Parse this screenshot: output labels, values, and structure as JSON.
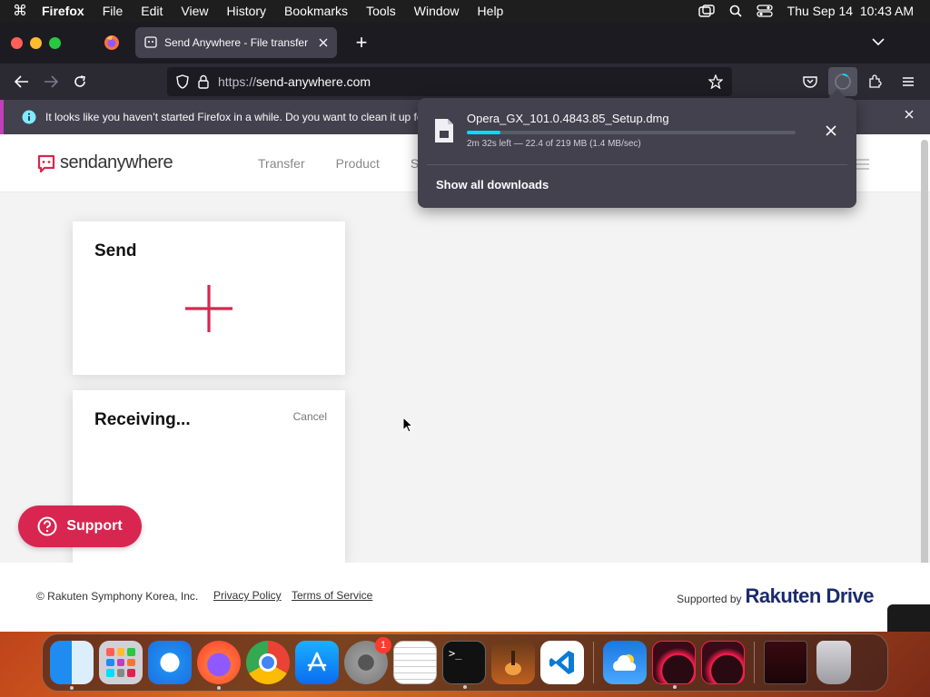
{
  "menubar": {
    "app": "Firefox",
    "items": [
      "File",
      "Edit",
      "View",
      "History",
      "Bookmarks",
      "Tools",
      "Window",
      "Help"
    ],
    "clock": "Thu Sep 14  10:43 AM"
  },
  "browser": {
    "tab_title": "Send Anywhere - File transfer",
    "url_proto": "https://",
    "url_host": "send-anywhere.com",
    "infobar_text": "It looks like you haven’t started Firefox in a while. Do you want to clean it up for"
  },
  "site": {
    "logo_text": "sendanywhere",
    "nav": [
      "Transfer",
      "Product",
      "Se"
    ],
    "send_title": "Send",
    "receiving_title": "Receiving...",
    "cancel_label": "Cancel",
    "support_label": "Support",
    "footer": {
      "copyright": "© Rakuten Symphony Korea, Inc.",
      "privacy": "Privacy Policy",
      "terms": "Terms of Service",
      "supported_by": "Supported by",
      "brand": "Rakuten Drive"
    }
  },
  "downloads": {
    "file_name": "Opera_GX_101.0.4843.85_Setup.dmg",
    "status": "2m 32s left — 22.4 of 219 MB (1.4 MB/sec)",
    "progress_fraction": 0.102,
    "show_all": "Show all downloads"
  },
  "dock": {
    "badge_count": "1"
  },
  "colors": {
    "accent": "#d82650",
    "progress": "#00ddff",
    "toolbar": "#2b2a33"
  }
}
